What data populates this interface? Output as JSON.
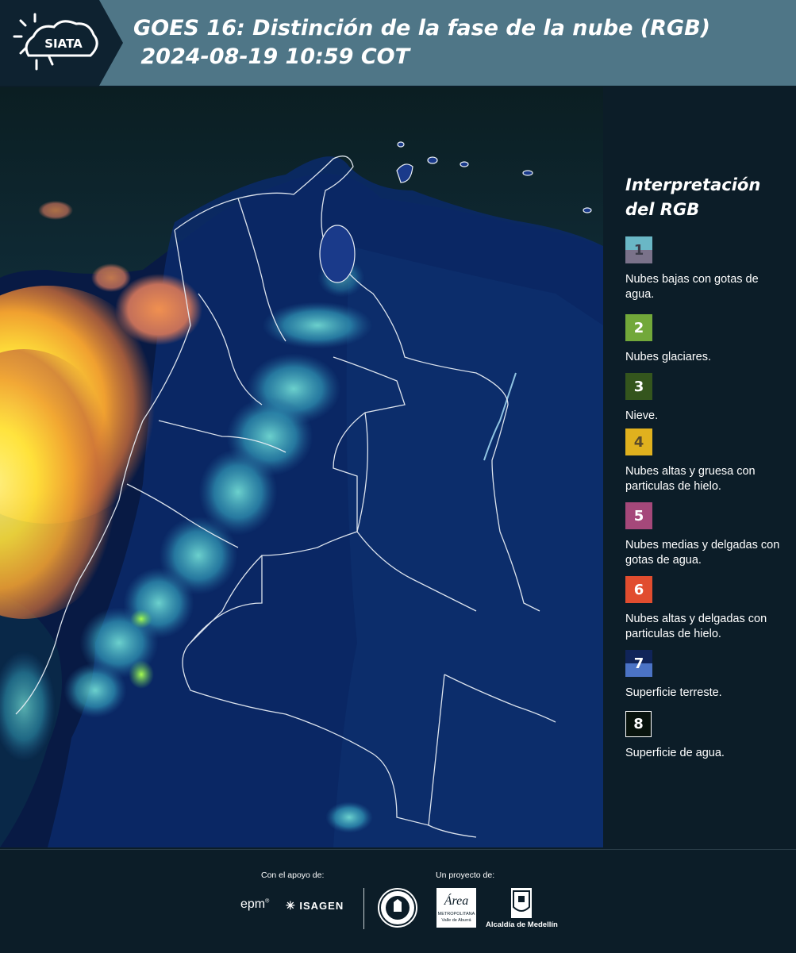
{
  "header": {
    "logo_text": "SIATA",
    "title_line1": "GOES 16: Distinción de la fase de la nube (RGB)",
    "title_line2": " 2024-08-19 10:59 COT",
    "colors": {
      "band": "#4f7687",
      "logo_bg": "#0e2230"
    }
  },
  "legend": {
    "title_line1": "Interpretación",
    "title_line2": "del RGB",
    "items": [
      {
        "number": "1",
        "label": "Nubes bajas con gotas de agua.",
        "color_top": "#6ab7c6",
        "color_bottom": "#7a728a"
      },
      {
        "number": "2",
        "label": "Nubes glaciares.",
        "color_top": "#72a83a",
        "color_bottom": "#72a83a"
      },
      {
        "number": "3",
        "label": "Nieve.",
        "color_top": "#34551d",
        "color_bottom": "#34551d"
      },
      {
        "number": "4",
        "label": "Nubes altas y gruesa con particulas de hielo.",
        "color_top": "#e0b11e",
        "color_bottom": "#e0b11e"
      },
      {
        "number": "5",
        "label": "Nubes medias y delgadas con gotas de agua.",
        "color_top": "#a5487a",
        "color_bottom": "#a5487a"
      },
      {
        "number": "6",
        "label": "Nubes altas y delgadas con particulas de hielo.",
        "color_top": "#e14d2f",
        "color_bottom": "#e14d2f"
      },
      {
        "number": "7",
        "label": "Superficie terreste.",
        "color_top": "#102459",
        "color_bottom": "#4b73c5"
      },
      {
        "number": "8",
        "label": "Superficie de agua.",
        "color_top": "#08130d",
        "color_bottom": "#08130d"
      }
    ]
  },
  "footer": {
    "support_label": "Con el apoyo de:",
    "project_label": "Un proyecto de:",
    "epm": "epm",
    "isagen": "ISAGEN",
    "area_text": "Área",
    "area_sub1": "METROPOLITANA",
    "area_sub2": "Valle de Aburrá",
    "alcaldia": "Alcaldía de Medellín"
  }
}
